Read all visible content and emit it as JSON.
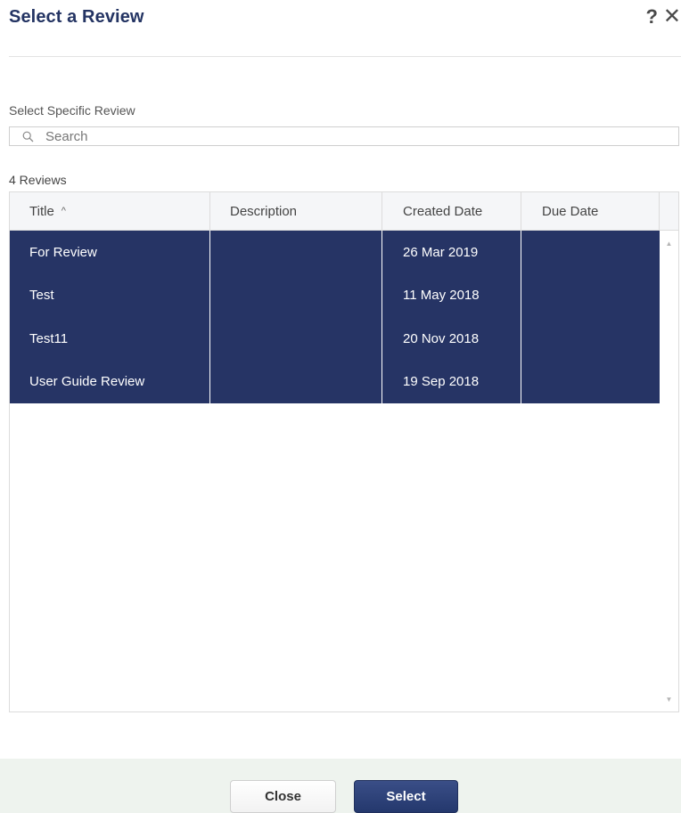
{
  "dialog": {
    "title": "Select a Review",
    "help_glyph": "?",
    "close_glyph": "✕"
  },
  "search": {
    "label": "Select Specific Review",
    "placeholder": "Search"
  },
  "list": {
    "count_label": "4 Reviews",
    "columns": {
      "title": "Title",
      "description": "Description",
      "created": "Created Date",
      "due": "Due Date"
    },
    "sort_indicator": "^",
    "rows": [
      {
        "title": "For Review",
        "description": "",
        "created": "26 Mar 2019",
        "due": ""
      },
      {
        "title": "Test",
        "description": "",
        "created": "11 May 2018",
        "due": ""
      },
      {
        "title": "Test11",
        "description": "",
        "created": "20 Nov 2018",
        "due": ""
      },
      {
        "title": "User Guide Review",
        "description": "",
        "created": "19 Sep 2018",
        "due": ""
      }
    ],
    "selected_row_color": "#263465"
  },
  "footer": {
    "close_label": "Close",
    "select_label": "Select"
  },
  "colors": {
    "title": "#243463",
    "primary_button": "#2a3d73",
    "footer_background": "#eef3ee"
  },
  "icons": {
    "search": "search-icon",
    "help": "help-icon",
    "close": "close-icon",
    "sort": "sort-ascending-icon"
  }
}
